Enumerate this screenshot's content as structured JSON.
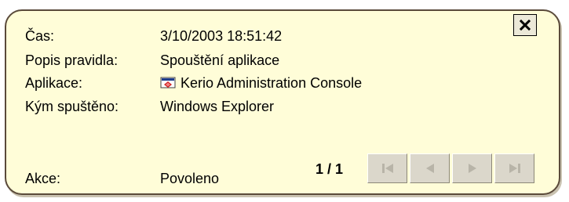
{
  "details": {
    "time_label": "Čas:",
    "time_value": "3/10/2003 18:51:42",
    "rule_label": "Popis pravidla:",
    "rule_value": "Spouštění aplikace",
    "app_label": "Aplikace:",
    "app_value": "Kerio Administration Console",
    "app_icon": "kerio-console-icon",
    "launched_by_label": "Kým spuštěno:",
    "launched_by_value": "Windows Explorer",
    "action_label": "Akce:",
    "action_value": "Povoleno"
  },
  "pager": {
    "counter": "1 / 1",
    "buttons": [
      "first-icon",
      "previous-icon",
      "next-icon",
      "last-icon"
    ]
  },
  "close": {
    "icon": "close-icon"
  },
  "colors": {
    "background": "#fffdd8",
    "border": "#5a4a3a",
    "button_face": "#dbd7cb",
    "disabled_icon": "#b8b4a8"
  }
}
